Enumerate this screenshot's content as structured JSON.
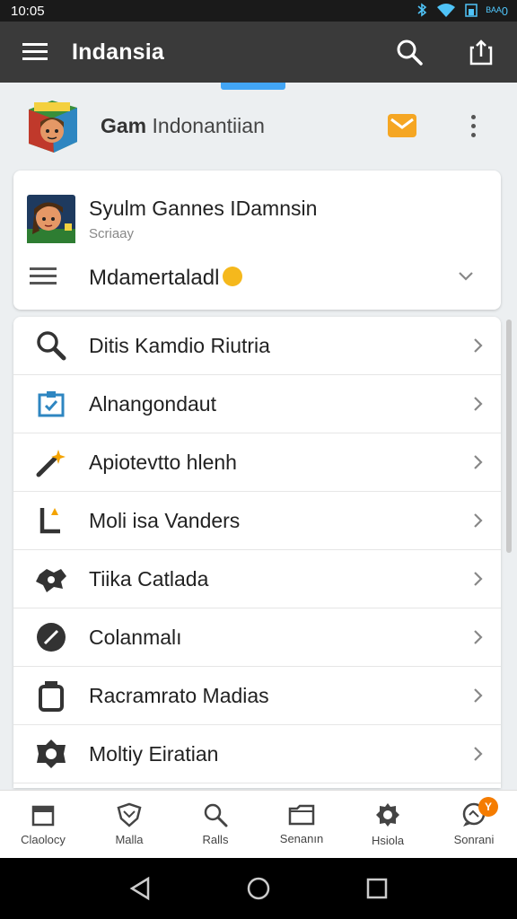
{
  "status_bar": {
    "time": "10:05",
    "battery_text": "ᴮᴬᴬ0"
  },
  "app_bar": {
    "title": "Indansia"
  },
  "profile": {
    "name_bold": "Gam",
    "name_rest": " Indonantiian"
  },
  "card": {
    "title": "Syulm Gannes IDamnsin",
    "subtitle": "Scriaay",
    "select_label": "Mdamertaladl"
  },
  "list": {
    "items": [
      {
        "label": "Ditis Kamdio Riutria",
        "icon": "search-icon"
      },
      {
        "label": "Alnangondaut",
        "icon": "clipboard-icon"
      },
      {
        "label": "Apiotevtto hlenh",
        "icon": "magic-wand-icon"
      },
      {
        "label": "Moli isa Vanders",
        "icon": "corner-icon"
      },
      {
        "label": "Tiika Catlada",
        "icon": "puzzle-icon"
      },
      {
        "label": "Colanmalı",
        "icon": "slash-circle-icon"
      },
      {
        "label": "Racramrato Madias",
        "icon": "jar-icon"
      },
      {
        "label": "Moltiy Eiratian",
        "icon": "flower-icon"
      }
    ]
  },
  "bottom_nav": {
    "items": [
      {
        "label": "Claolocy",
        "icon": "calendar-icon"
      },
      {
        "label": "Malla",
        "icon": "shield-icon"
      },
      {
        "label": "Ralls",
        "icon": "search-icon"
      },
      {
        "label": "Senanın",
        "icon": "folder-icon"
      },
      {
        "label": "Hsiola",
        "icon": "gear-icon"
      },
      {
        "label": "Sonrani",
        "icon": "chat-icon",
        "badge": "Y"
      }
    ]
  },
  "colors": {
    "app_bar": "#3a3a3a",
    "accent": "#42a5f5",
    "mail": "#f5a623",
    "badge": "#f57c00"
  }
}
